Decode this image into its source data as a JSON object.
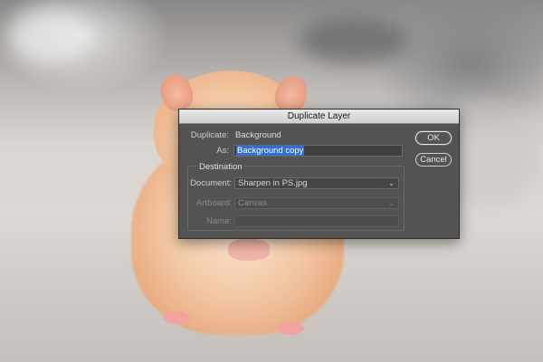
{
  "dialog": {
    "title": "Duplicate Layer",
    "duplicate_label": "Duplicate:",
    "duplicate_value": "Background",
    "as_label": "As:",
    "as_value": "Background copy",
    "destination": {
      "group_title": "Destination",
      "document_label": "Document:",
      "document_value": "Sharpen in PS.jpg",
      "artboard_label": "Artboard:",
      "artboard_value": "Canvas",
      "name_label": "Name:",
      "name_value": ""
    },
    "buttons": {
      "ok": "OK",
      "cancel": "Cancel"
    }
  },
  "icons": {
    "document_dropdown": "chevron-down-icon",
    "artboard_dropdown": "chevron-down-icon"
  },
  "colors": {
    "dialog_bg": "#535353",
    "selection": "#2f6fd6",
    "titlebar": "#dcdcdc"
  }
}
